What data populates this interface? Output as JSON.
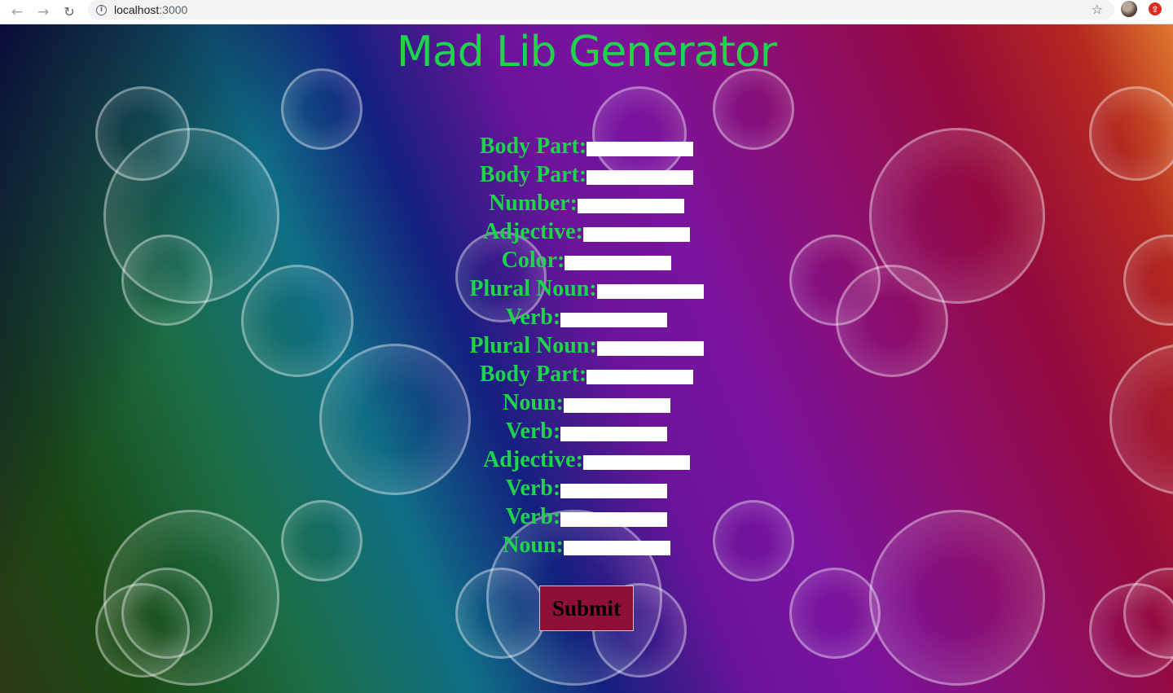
{
  "browser": {
    "url_host": "localhost",
    "url_port": ":3000",
    "back_icon": "arrow-left-icon",
    "forward_icon": "arrow-right-icon",
    "reload_icon": "reload-icon",
    "info_icon": "info-icon",
    "star_icon": "star-icon",
    "extension_icon": "extension-icon"
  },
  "page": {
    "title": "Mad Lib Generator",
    "fields": [
      {
        "label": "Body Part:",
        "value": ""
      },
      {
        "label": "Body Part:",
        "value": ""
      },
      {
        "label": "Number:",
        "value": ""
      },
      {
        "label": "Adjective:",
        "value": ""
      },
      {
        "label": "Color:",
        "value": ""
      },
      {
        "label": "Plural Noun:",
        "value": ""
      },
      {
        "label": "Verb:",
        "value": ""
      },
      {
        "label": "Plural Noun:",
        "value": ""
      },
      {
        "label": "Body Part:",
        "value": ""
      },
      {
        "label": "Noun:",
        "value": ""
      },
      {
        "label": "Verb:",
        "value": ""
      },
      {
        "label": "Adjective:",
        "value": ""
      },
      {
        "label": "Verb:",
        "value": ""
      },
      {
        "label": "Verb:",
        "value": ""
      },
      {
        "label": "Noun:",
        "value": ""
      }
    ],
    "submit_label": "Submit"
  },
  "colors": {
    "title": "#1fd34c",
    "label": "#1fd34c",
    "submit_bg": "#8e1036"
  }
}
